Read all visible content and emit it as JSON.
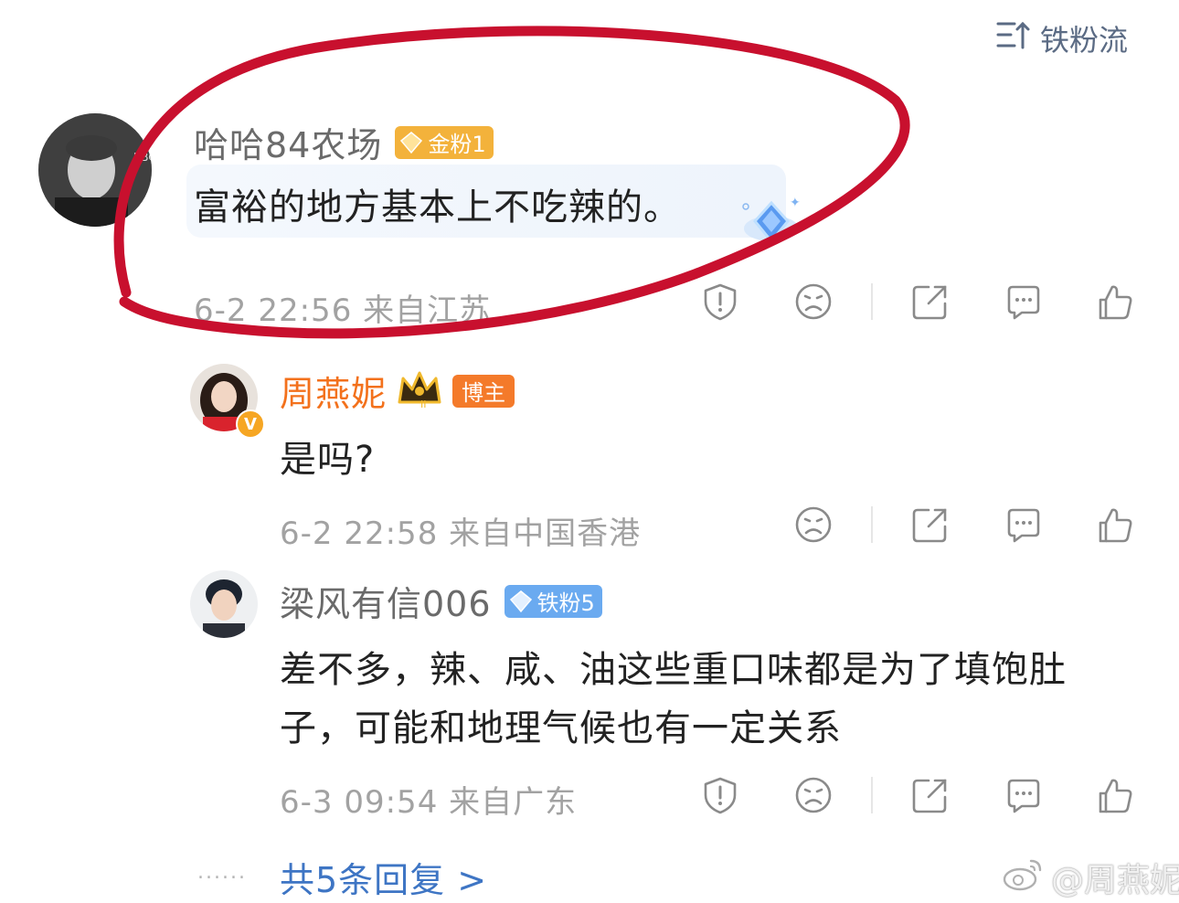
{
  "sort": {
    "label": "铁粉流"
  },
  "comments": [
    {
      "username": "哈哈84农场",
      "badge": "金粉1",
      "text": "富裕的地方基本上不吃辣的。",
      "meta": "6-2 22:56 来自江苏"
    },
    {
      "username": "周燕妮",
      "badge": "博主",
      "text": "是吗?",
      "meta": "6-2 22:58 来自中国香港"
    },
    {
      "username": "梁风有信006",
      "badge": "铁粉5",
      "text_line1": "差不多，辣、咸、油这些重口味都是为了填饱肚",
      "text_line2": "子，可能和地理气候也有一定关系",
      "meta": "6-3 09:54 来自广东"
    }
  ],
  "footer": {
    "dots": "......",
    "more_replies": "共5条回复 >",
    "watermark": "@周燕妮"
  },
  "colors": {
    "annotation_circle": "#c8102e",
    "owner_name": "#f3711c",
    "link": "#3e75c4"
  }
}
